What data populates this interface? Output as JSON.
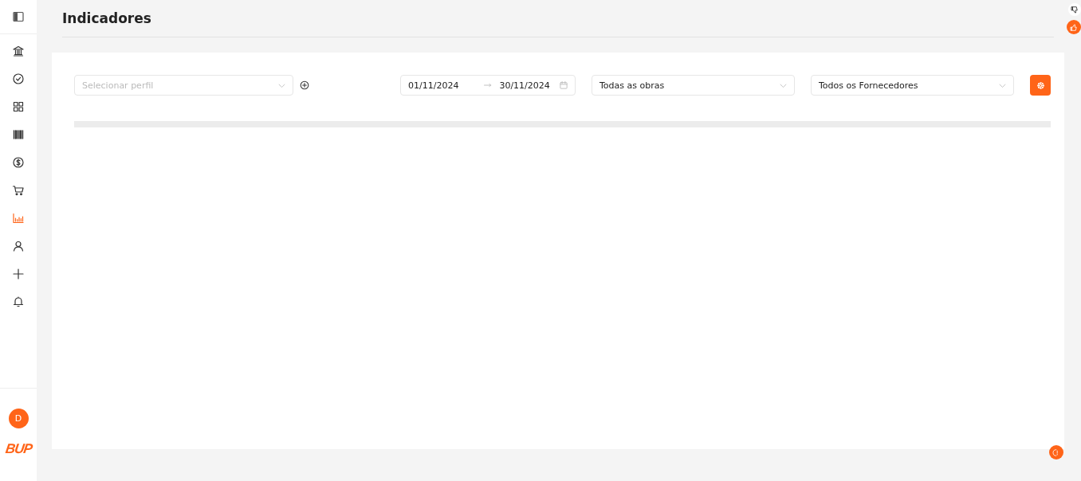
{
  "sidebar": {
    "items": [
      {
        "kind": "bank",
        "selected": false
      },
      {
        "kind": "check",
        "selected": false
      },
      {
        "kind": "grid",
        "selected": false
      },
      {
        "kind": "barcode",
        "selected": false
      },
      {
        "kind": "dollar",
        "selected": false
      },
      {
        "kind": "cart",
        "selected": false
      },
      {
        "kind": "chart",
        "selected": true
      },
      {
        "kind": "user",
        "selected": false
      },
      {
        "kind": "plus",
        "selected": false
      },
      {
        "kind": "bell",
        "selected": false
      }
    ],
    "avatar": {
      "initial": "D"
    },
    "logo": {
      "text": "BUP"
    }
  },
  "page": {
    "title": "Indicadores"
  },
  "filters": {
    "profile": {
      "placeholder": "Selecionar perfil"
    },
    "date_range": {
      "start": "01/11/2024",
      "end": "30/11/2024"
    },
    "works": {
      "value": "Todas as obras"
    },
    "suppliers": {
      "value": "Todos os Fornecedores"
    }
  }
}
